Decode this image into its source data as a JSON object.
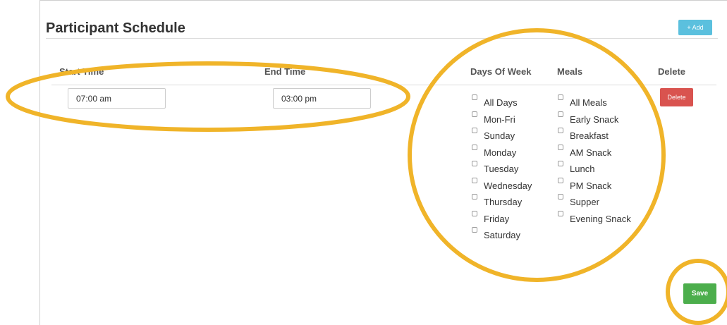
{
  "header": {
    "title": "Participant Schedule",
    "add_label": "Add"
  },
  "table": {
    "columns": {
      "start_time": "Start Time",
      "end_time": "End Time",
      "days": "Days Of Week",
      "meals": "Meals",
      "delete": "Delete"
    },
    "row": {
      "start_time": "07:00 am",
      "end_time": "03:00 pm",
      "days": [
        {
          "label": "All Days",
          "checked": false
        },
        {
          "label": "Mon-Fri",
          "checked": false
        },
        {
          "label": "Sunday",
          "checked": false
        },
        {
          "label": "Monday",
          "checked": false
        },
        {
          "label": "Tuesday",
          "checked": false
        },
        {
          "label": "Wednesday",
          "checked": false
        },
        {
          "label": "Thursday",
          "checked": false
        },
        {
          "label": "Friday",
          "checked": false
        },
        {
          "label": "Saturday",
          "checked": false
        }
      ],
      "meals": [
        {
          "label": "All Meals",
          "checked": false
        },
        {
          "label": "Early Snack",
          "checked": false
        },
        {
          "label": "Breakfast",
          "checked": false
        },
        {
          "label": "AM Snack",
          "checked": false
        },
        {
          "label": "Lunch",
          "checked": false
        },
        {
          "label": "PM Snack",
          "checked": false
        },
        {
          "label": "Supper",
          "checked": false
        },
        {
          "label": "Evening Snack",
          "checked": false
        }
      ],
      "delete_label": "Delete"
    }
  },
  "footer": {
    "save_label": "Save"
  },
  "colors": {
    "add_button": "#5bc0de",
    "delete_button": "#d9534f",
    "save_button": "#4cae4c",
    "highlight_annotation": "#f0b429"
  }
}
